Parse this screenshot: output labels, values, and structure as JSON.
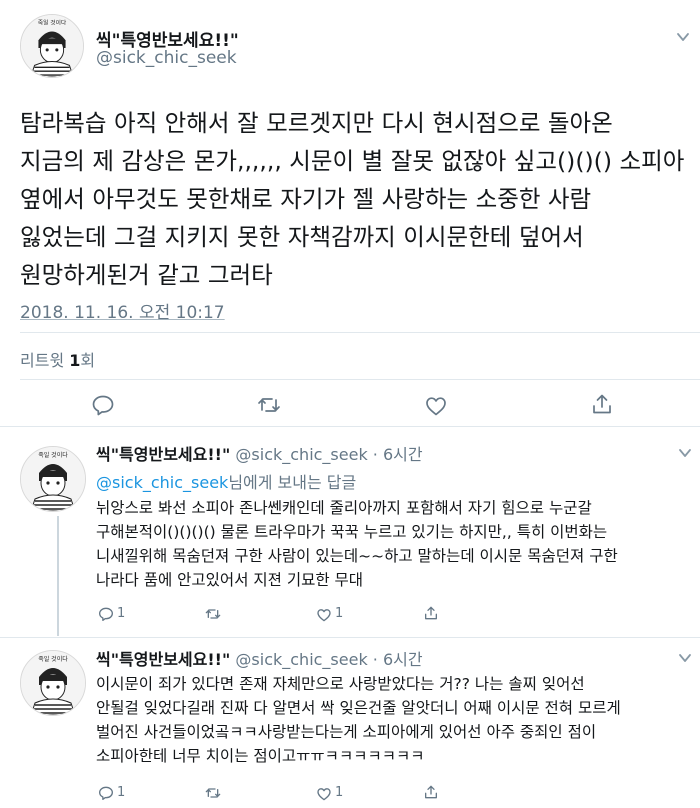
{
  "main_tweet": {
    "display_name": "씩\"특영반보세요!!\"",
    "handle": "@sick_chic_seek",
    "text_lines": [
      "탐라복습 아직 안해서 잘 모르겟지만 다시 현시점으로 돌아온",
      "지금의 제 감상은 몬가,,,,,, 시문이 별 잘못 없잖아 싶고()()() 소피아",
      "옆에서 아무것도 못한채로 자기가 젤 사랑하는 소중한 사람",
      "잃었는데 그걸 지키지 못한 자책감까지 이시문한테 덮어서",
      "원망하게된거 같고 그러타"
    ],
    "timestamp": "2018. 11. 16. 오전 10:17",
    "retweet_label": "리트윗",
    "retweet_count": "1",
    "retweet_suffix": "회"
  },
  "replies": [
    {
      "display_name": "씩\"특영반보세요!!\"",
      "handle_time": "@sick_chic_seek · 6시간",
      "reply_mention": "@sick_chic_seek",
      "reply_suffix": "님에게 보내는 답글",
      "text_lines": [
        "뉘앙스로 봐선 소피아 존나쎈캐인데 줄리아까지 포함해서 자기 힘으로 누군갈",
        "구해본적이()()()() 물론 트라우마가 꾹꾹 누르고 있기는 하지만,, 특히 이번화는",
        "니새낄위해 목숨던져 구한 사람이 있는데~~하고 말하는데 이시문 목숨던져 구한",
        "나라다 품에 안고있어서 지젼 기묘한 무대"
      ],
      "reply_count": "1",
      "like_count": "1"
    },
    {
      "display_name": "씩\"특영반보세요!!\"",
      "handle_time": "@sick_chic_seek · 6시간",
      "text_lines": [
        "이시문이 죄가 있다면 존재 자체만으로 사랑받았다는 거?? 나는 솔찌 잊어선",
        "안될걸 잊었다길래 진짜 다 알면서 싹 잊은건줄 알앗더니 어째 이시문 전혀 모르게",
        "벌어진 사건들이었곸ㅋㅋ사랑받는다는게 소피아에게 있어선 아주 중죄인 점이",
        "소피아한테 너무 치이는 점이고ㅠㅠㅋㅋㅋㅋㅋㅋㅋ"
      ],
      "reply_count": "1",
      "like_count": "1"
    }
  ],
  "avatar_caption": "죽일 것이다",
  "colors": {
    "text": "#14171a",
    "secondary": "#657786",
    "link": "#1b95e0",
    "divider": "#e1e8ed"
  }
}
